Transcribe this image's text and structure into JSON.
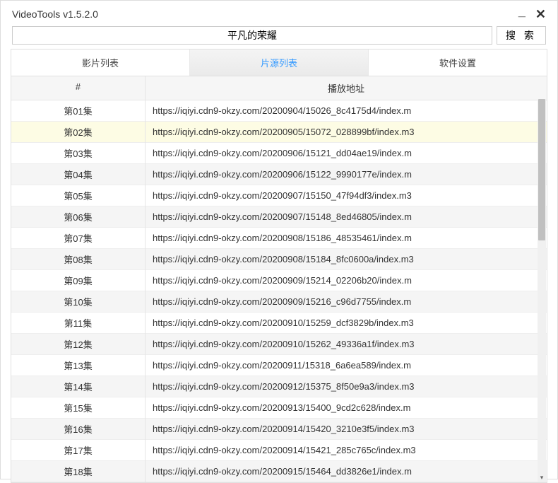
{
  "window": {
    "title": "VideoTools v1.5.2.0"
  },
  "search": {
    "value": "平凡的荣耀",
    "button": "搜 索"
  },
  "tabs": [
    {
      "label": "影片列表",
      "active": false
    },
    {
      "label": "片源列表",
      "active": true
    },
    {
      "label": "软件设置",
      "active": false
    }
  ],
  "table": {
    "headers": {
      "index": "#",
      "url": "播放地址"
    },
    "selected_index": 1,
    "rows": [
      {
        "ep": "第01集",
        "url": "https://iqiyi.cdn9-okzy.com/20200904/15026_8c4175d4/index.m"
      },
      {
        "ep": "第02集",
        "url": "https://iqiyi.cdn9-okzy.com/20200905/15072_028899bf/index.m3"
      },
      {
        "ep": "第03集",
        "url": "https://iqiyi.cdn9-okzy.com/20200906/15121_dd04ae19/index.m"
      },
      {
        "ep": "第04集",
        "url": "https://iqiyi.cdn9-okzy.com/20200906/15122_9990177e/index.m"
      },
      {
        "ep": "第05集",
        "url": "https://iqiyi.cdn9-okzy.com/20200907/15150_47f94df3/index.m3"
      },
      {
        "ep": "第06集",
        "url": "https://iqiyi.cdn9-okzy.com/20200907/15148_8ed46805/index.m"
      },
      {
        "ep": "第07集",
        "url": "https://iqiyi.cdn9-okzy.com/20200908/15186_48535461/index.m"
      },
      {
        "ep": "第08集",
        "url": "https://iqiyi.cdn9-okzy.com/20200908/15184_8fc0600a/index.m3"
      },
      {
        "ep": "第09集",
        "url": "https://iqiyi.cdn9-okzy.com/20200909/15214_02206b20/index.m"
      },
      {
        "ep": "第10集",
        "url": "https://iqiyi.cdn9-okzy.com/20200909/15216_c96d7755/index.m"
      },
      {
        "ep": "第11集",
        "url": "https://iqiyi.cdn9-okzy.com/20200910/15259_dcf3829b/index.m3"
      },
      {
        "ep": "第12集",
        "url": "https://iqiyi.cdn9-okzy.com/20200910/15262_49336a1f/index.m3"
      },
      {
        "ep": "第13集",
        "url": "https://iqiyi.cdn9-okzy.com/20200911/15318_6a6ea589/index.m"
      },
      {
        "ep": "第14集",
        "url": "https://iqiyi.cdn9-okzy.com/20200912/15375_8f50e9a3/index.m3"
      },
      {
        "ep": "第15集",
        "url": "https://iqiyi.cdn9-okzy.com/20200913/15400_9cd2c628/index.m"
      },
      {
        "ep": "第16集",
        "url": "https://iqiyi.cdn9-okzy.com/20200914/15420_3210e3f5/index.m3"
      },
      {
        "ep": "第17集",
        "url": "https://iqiyi.cdn9-okzy.com/20200914/15421_285c765c/index.m3"
      },
      {
        "ep": "第18集",
        "url": "https://iqiyi.cdn9-okzy.com/20200915/15464_dd3826e1/index.m"
      }
    ]
  }
}
